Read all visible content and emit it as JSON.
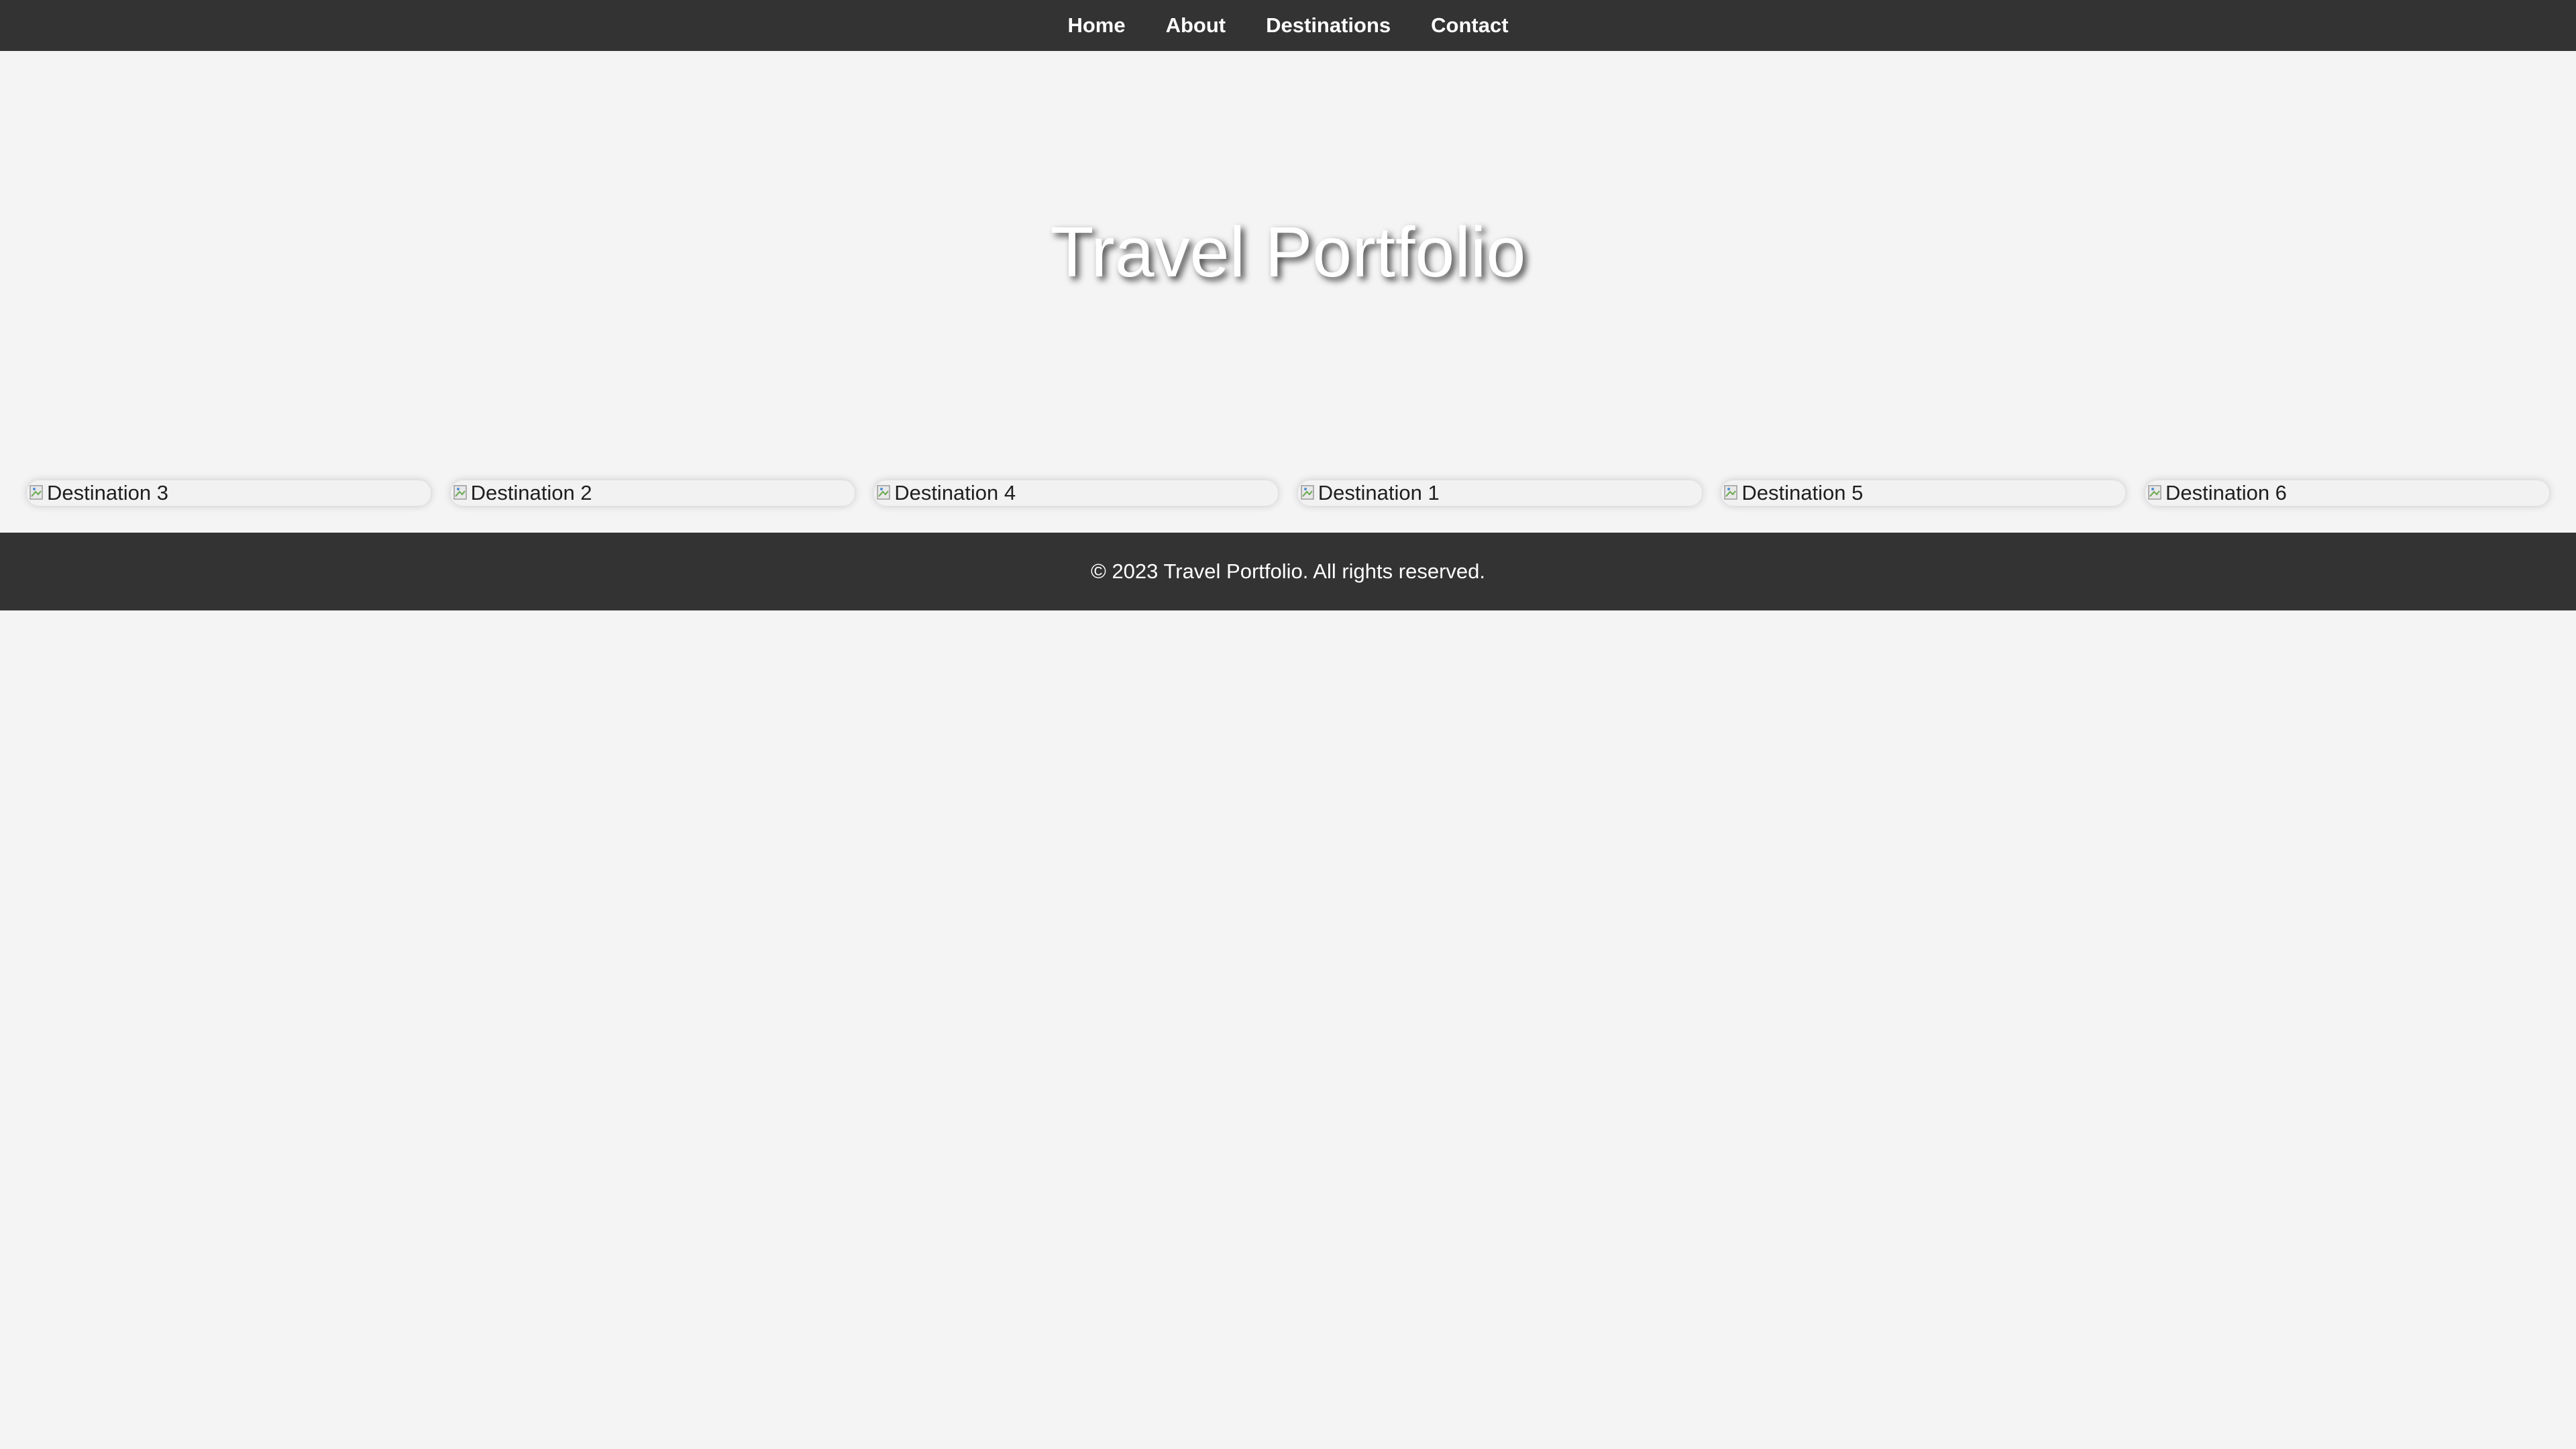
{
  "nav": {
    "items": [
      {
        "label": "Home"
      },
      {
        "label": "About"
      },
      {
        "label": "Destinations"
      },
      {
        "label": "Contact"
      }
    ]
  },
  "hero": {
    "title": "Travel Portfolio"
  },
  "gallery": {
    "items": [
      {
        "alt": "Destination 3"
      },
      {
        "alt": "Destination 2"
      },
      {
        "alt": "Destination 4"
      },
      {
        "alt": "Destination 1"
      },
      {
        "alt": "Destination 5"
      },
      {
        "alt": "Destination 6"
      }
    ]
  },
  "footer": {
    "text": "© 2023 Travel Portfolio. All rights reserved."
  },
  "colors": {
    "background": "#f4f4f4",
    "bar": "#333333",
    "text_light": "#ffffff"
  }
}
